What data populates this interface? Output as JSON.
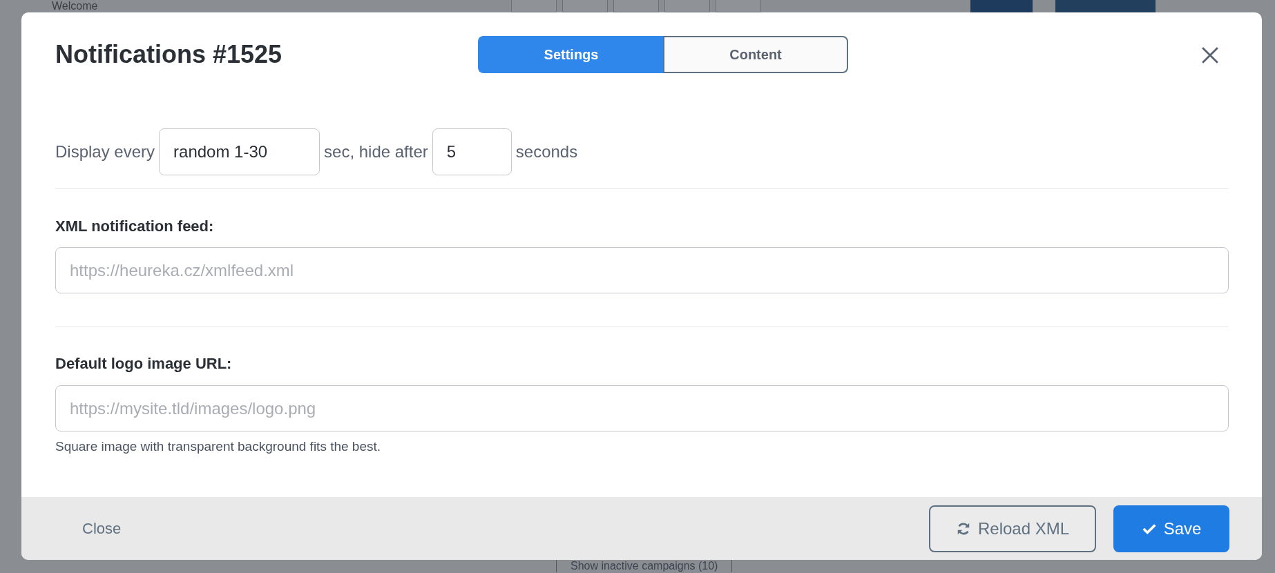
{
  "background": {
    "heading": "Welcome",
    "link": "Show inactive campaigns (10)"
  },
  "dialog": {
    "title": "Notifications #1525",
    "tabs": [
      {
        "label": "Settings",
        "selected": true
      },
      {
        "label": "Content",
        "selected": false
      }
    ],
    "timing": {
      "prefix": "Display every",
      "interval": "random 1-30",
      "middle": "sec, hide after",
      "hide_after": "5",
      "suffix": "seconds"
    },
    "feed": {
      "label": "XML notification feed:",
      "placeholder": "https://heureka.cz/xmlfeed.xml"
    },
    "logo": {
      "label": "Default logo image URL:",
      "placeholder": "https://mysite.tld/images/logo.png",
      "help": "Square image with transparent background fits the best."
    },
    "footer": {
      "close": "Close",
      "reload": "Reload XML",
      "save": "Save"
    }
  }
}
